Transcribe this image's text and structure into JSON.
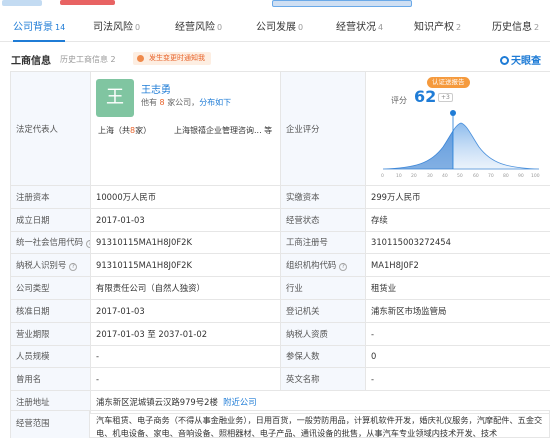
{
  "tabs": [
    {
      "label": "公司背景",
      "count": "14"
    },
    {
      "label": "司法风险",
      "count": "0"
    },
    {
      "label": "经营风险",
      "count": "0"
    },
    {
      "label": "公司发展",
      "count": "0"
    },
    {
      "label": "经营状况",
      "count": "4"
    },
    {
      "label": "知识产权",
      "count": "2"
    },
    {
      "label": "历史信息",
      "count": "2"
    }
  ],
  "section": {
    "title": "工商信息",
    "subtitle": "历史工商信息",
    "subtitle_count": "2",
    "badge": "发生变更时通知我",
    "brand": "天眼查"
  },
  "legal_rep": {
    "label": "法定代表人",
    "avatar_char": "王",
    "name": "王志勇",
    "summary_pre": "他有",
    "summary_count": "8",
    "summary_mid": "家公司，",
    "summary_link": "分布如下",
    "loc_pre": "上海（共",
    "loc_count": "8",
    "loc_post": "家）",
    "company": "上海银禧企业管理咨询... 等"
  },
  "score": {
    "label": "企业评分",
    "button": "认证送报告",
    "prefix": "评分",
    "value": "62",
    "plus": "+3"
  },
  "rows": [
    [
      "注册资本",
      "10000万人民币",
      "实缴资本",
      "299万人民币"
    ],
    [
      "成立日期",
      "2017-01-03",
      "经营状态",
      "存续"
    ],
    [
      "统一社会信用代码",
      "91310115MA1H8J0F2K",
      "工商注册号",
      "310115003272454"
    ],
    [
      "纳税人识别号",
      "91310115MA1H8J0F2K",
      "组织机构代码",
      "MA1H8J0F2"
    ],
    [
      "公司类型",
      "有限责任公司（自然人独资）",
      "行业",
      "租赁业"
    ],
    [
      "核准日期",
      "2017-01-03",
      "登记机关",
      "浦东新区市场监管局"
    ],
    [
      "营业期限",
      "2017-01-03 至 2037-01-02",
      "纳税人资质",
      "-"
    ],
    [
      "人员规模",
      "-",
      "参保人数",
      "0"
    ],
    [
      "曾用名",
      "-",
      "英文名称",
      "-"
    ]
  ],
  "address": {
    "label": "注册地址",
    "value": "浦东新区泥城镇云汉路979号2楼",
    "link": "附近公司"
  },
  "scope": {
    "label": "经营范围",
    "text": "汽车租赁、电子商务（不得从事金融业务），日用百货，一般劳防用品，计算机软件开发，婚庆礼仪服务，汽摩配件、五金交电、机电设备、家电、音响设备、照相器材、电子产品、通讯设备的批售，从事汽车专业领域内技术开发、技术"
  },
  "colors": {
    "accent": "#1f7cd6",
    "orange": "#e8632a",
    "label_bg": "#f5f8fd"
  }
}
